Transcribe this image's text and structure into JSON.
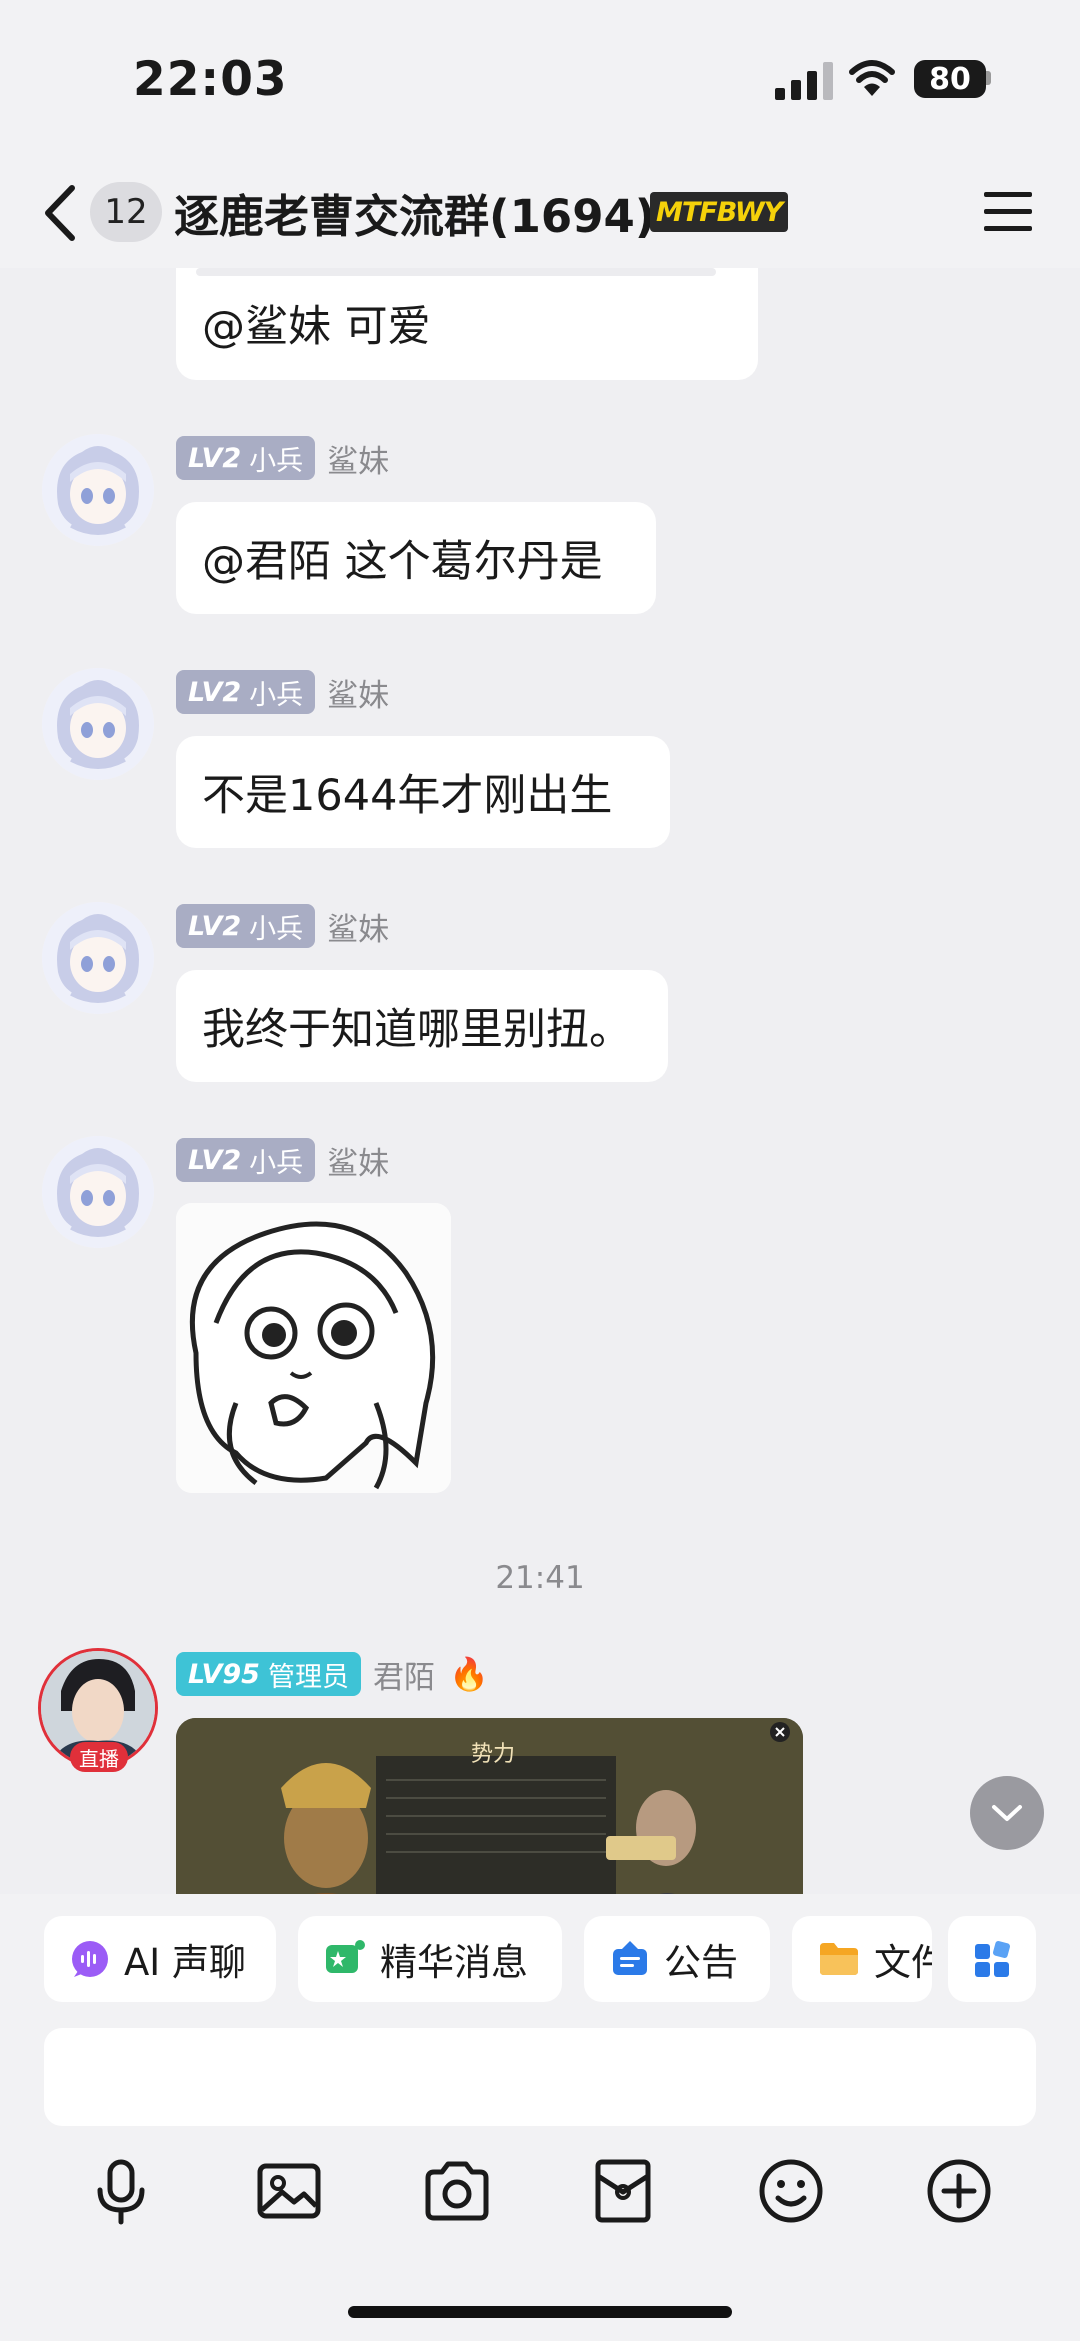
{
  "status_bar": {
    "time": "22:03",
    "battery": "80"
  },
  "header": {
    "unread_count": "12",
    "title": "逐鹿老曹交流群(1694)",
    "brand_badge": "MTFBWY"
  },
  "messages": [
    {
      "sender": "",
      "text": "@鲨妹 可爱"
    },
    {
      "level": "LV2",
      "role": "小兵",
      "sender": "鲨妹",
      "text": "@君陌 这个葛尔丹是"
    },
    {
      "level": "LV2",
      "role": "小兵",
      "sender": "鲨妹",
      "text": "不是1644年才刚出生"
    },
    {
      "level": "LV2",
      "role": "小兵",
      "sender": "鲨妹",
      "text": "我终于知道哪里别扭。"
    },
    {
      "level": "LV2",
      "role": "小兵",
      "sender": "鲨妹",
      "image": "sticker"
    }
  ],
  "timestamp": "21:41",
  "admin_message": {
    "level": "LV95",
    "role": "管理员",
    "sender": "君陌",
    "live_badge": "直播",
    "flame": "🔥",
    "game_title": "势力"
  },
  "quick_actions": [
    {
      "label": "AI 声聊",
      "icon": "ai-voice-icon"
    },
    {
      "label": "精华消息",
      "icon": "highlight-icon"
    },
    {
      "label": "公告",
      "icon": "announcement-icon"
    },
    {
      "label": "文件",
      "icon": "folder-icon"
    }
  ],
  "input": {
    "placeholder": ""
  },
  "toolbar": [
    "mic-icon",
    "image-icon",
    "camera-icon",
    "red-packet-icon",
    "emoji-icon",
    "add-icon"
  ],
  "colors": {
    "background": "#efeff2",
    "bubble": "#ffffff",
    "lv_badge": "#a9adc4",
    "admin_badge": "#3ec3d6",
    "live_red": "#e0303a"
  }
}
